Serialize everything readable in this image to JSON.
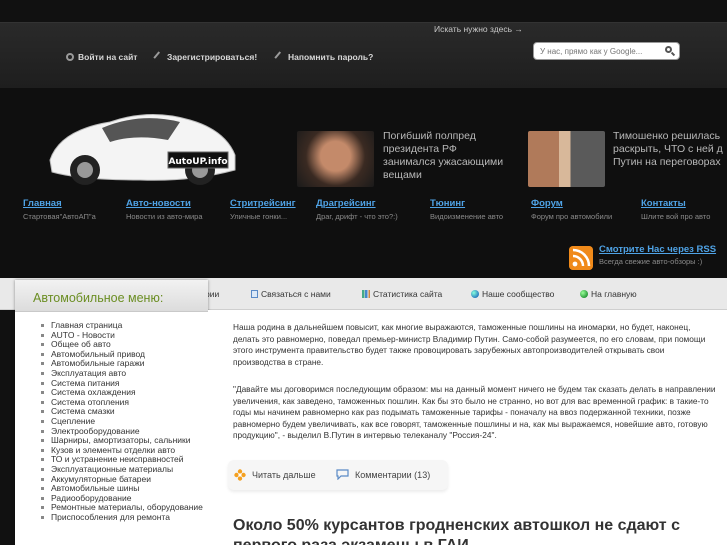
{
  "topbar": {
    "login": "Войти на сайт",
    "register": "Зарегистрироваться!",
    "remind": "Напомнить пароль?",
    "search_label": "Искать нужно здесь →",
    "search_placeholder": "У нас, прямо как у Google..."
  },
  "logo_text": "AutoUP.info",
  "news": [
    {
      "title": "Погибший полпред президента РФ занимался ужасающими вещами"
    },
    {
      "title": "Тимошенко решилась раскрыть, ЧТО с ней д Путин на переговорах"
    }
  ],
  "nav": [
    {
      "title": "Главная",
      "sub": "Стартовая\"АвтоАП\"а"
    },
    {
      "title": "Авто-новости",
      "sub": "Новости из авто-мира"
    },
    {
      "title": "Стритрейсинг",
      "sub": "Уличные гонки..."
    },
    {
      "title": "Драгрейсинг",
      "sub": "Драг, дрифт - что это?:)"
    },
    {
      "title": "Тюнинг",
      "sub": "Видоизменение авто"
    },
    {
      "title": "Форум",
      "sub": "Форум про автомобили"
    },
    {
      "title": "Контакты",
      "sub": "Шлите вой про авто"
    }
  ],
  "rss": {
    "title": "Смотрите Нас через RSS",
    "sub": "Всегда свежие авто-обзоры :)"
  },
  "subnav": {
    "rules": "рии",
    "contact": "Связаться с нами",
    "stats": "Статистика сайта",
    "community": "Наше сообщество",
    "home": "На главную"
  },
  "sidebar": {
    "title": "Автомобильное меню:",
    "items": [
      "Главная страница",
      "AUTO - Новости",
      "Общее об авто",
      "Автомобильный привод",
      "Автомобильные гаражи",
      "Эксплуатация авто",
      "Система питания",
      "Система охлаждения",
      "Система отопления",
      "Система смазки",
      "Сцепление",
      "Электрооборудование",
      "Шарниры, амортизаторы, сальники",
      "Кузов и элементы отделки авто",
      "ТО и устранение неисправностей",
      "Эксплуатационные материалы",
      "Аккумуляторные батареи",
      "Автомобильные шины",
      "Радиооборудование",
      "Ремонтные материалы, оборудование",
      "Приспособления для ремонта"
    ]
  },
  "article": {
    "p1": "Наша родина в дальнейшем повысит, как многие выражаются, таможенные пошлины на иномарки, но будет, наконец, делать это равномерно, поведал премьер-министр Владимир Путин. Само-собой разумеется, по его словам, при помощи этого инструмента правительство будет также провоцировать зарубежных автопроизводителей открывать свои производства в стране.",
    "p2": "\"Давайте мы договоримся последующим образом: мы на данный момент ничего не будем так сказать делать в направлении увеличения, как заведено, таможенных пошлин. Как бы это было не странно, но вот для вас временной график: в такие-то годы мы начинем равномерно как раз подымать таможенные тарифы - поначалу на ввоз подержанной техники, позже равномерно будем увеличивать, как все говорят, таможенные пошлины и на, как мы выражаемся, новейшие авто, готовую продукцию\", - выделил В.Путин в интервью телеканалу \"Россия-24\".",
    "read_more": "Читать дальше",
    "comments": "Комментарии (13)",
    "next_title": "Около 50% курсантов гродненских автошкол не сдают с первого раза экзамены в ГАИ"
  }
}
